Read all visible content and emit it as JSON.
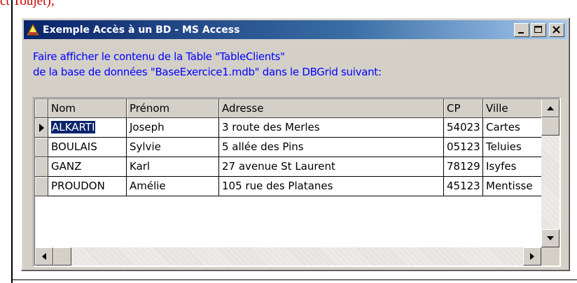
{
  "page": {
    "top_fragment": "ct Toujet);"
  },
  "window": {
    "title": "Exemple Accès à un BD - MS Access",
    "title_icon": "access-app-icon",
    "buttons": [
      "minimize",
      "maximize",
      "close"
    ]
  },
  "instructions": {
    "line1": "Faire afficher le contenu de la Table \"TableClients\"",
    "line2": "de la base de données \"BaseExercice1.mdb\" dans le DBGrid suivant:"
  },
  "grid": {
    "columns": [
      "Nom",
      "Prénom",
      "Adresse",
      "CP",
      "Ville"
    ],
    "rows": [
      {
        "nom": "ALKARTI",
        "prenom": "Joseph",
        "adresse": "3 route des Merles",
        "cp": "54023",
        "ville": "Cartes"
      },
      {
        "nom": "BOULAIS",
        "prenom": "Sylvie",
        "adresse": "5 allée des Pins",
        "cp": "05123",
        "ville": "Teluies"
      },
      {
        "nom": "GANZ",
        "prenom": "Karl",
        "adresse": "27 avenue St Laurent",
        "cp": "78129",
        "ville": "Isyfes"
      },
      {
        "nom": "PROUDON",
        "prenom": "Amélie",
        "adresse": "105 rue des Platanes",
        "cp": "45123",
        "ville": "Mentisse"
      }
    ],
    "current_row": 0,
    "current_column": 0
  },
  "colors": {
    "title_gradient_start": "#0a246a",
    "instruction_text": "#0000ff",
    "selection": "#0a246a",
    "face": "#d4d0c8"
  }
}
